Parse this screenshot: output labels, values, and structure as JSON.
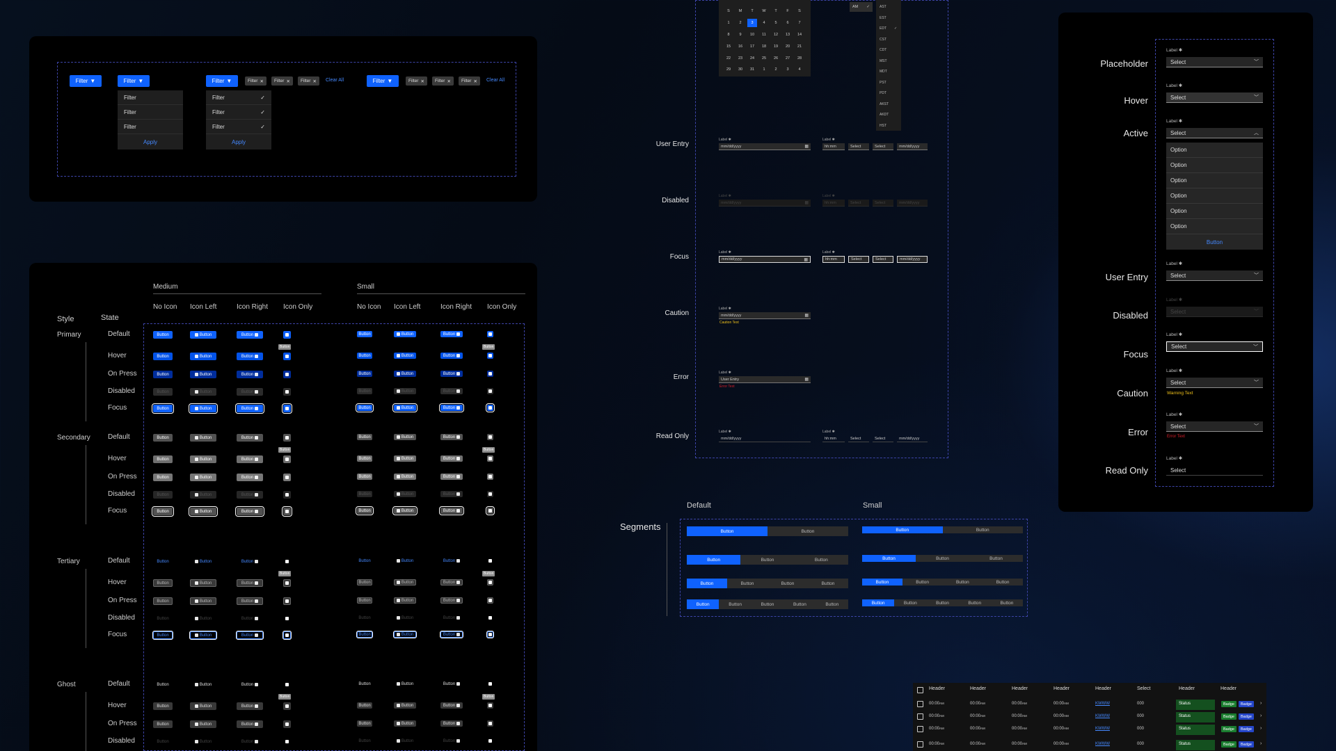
{
  "filters": {
    "filter_label": "Filter",
    "chip_label": "Filter",
    "clear_all": "Clear All",
    "apply": "Apply",
    "menu_items": [
      "Filter",
      "Filter",
      "Filter"
    ]
  },
  "buttons_matrix": {
    "size_headers": [
      "Medium",
      "Small"
    ],
    "col_headers": [
      "No Icon",
      "Icon Left",
      "Icon Right",
      "Icon Only",
      "No Icon",
      "Icon Left",
      "Icon Right",
      "Icon Only"
    ],
    "style_header": "Style",
    "state_header": "State",
    "button_label": "Button",
    "styles": [
      {
        "name": "Primary",
        "states": [
          "Default",
          "Hover",
          "On Press",
          "Disabled",
          "Focus"
        ]
      },
      {
        "name": "Secondary",
        "states": [
          "Default",
          "Hover",
          "On Press",
          "Disabled",
          "Focus"
        ]
      },
      {
        "name": "Tertiary",
        "states": [
          "Default",
          "Hover",
          "On Press",
          "Disabled",
          "Focus"
        ]
      },
      {
        "name": "Ghost",
        "states": [
          "Default",
          "Hover",
          "On Press",
          "Disabled"
        ]
      }
    ]
  },
  "date_inputs": {
    "row_labels": [
      "User Entry",
      "Disabled",
      "Focus",
      "Caution",
      "Error",
      "Read Only"
    ],
    "field_label": "Label ✱",
    "date_placeholder": "mm/dd/yyyy",
    "time_placeholder": "hh:mm",
    "select_label": "Select",
    "user_entry_value": "User Entry",
    "caution_text": "Caution Text",
    "error_text": "Error Text",
    "calendar": {
      "weekdays": [
        "S",
        "M",
        "T",
        "W",
        "T",
        "F",
        "S"
      ],
      "weeks": [
        [
          "",
          "1",
          "2",
          "3",
          "4",
          "5",
          "6",
          "7"
        ],
        [
          "8",
          "9",
          "10",
          "11",
          "12",
          "13",
          "14"
        ],
        [
          "15",
          "16",
          "17",
          "18",
          "19",
          "20",
          "21"
        ],
        [
          "22",
          "23",
          "24",
          "25",
          "26",
          "27",
          "28"
        ],
        [
          "29",
          "30",
          "31",
          "1",
          "2",
          "3",
          "4"
        ]
      ],
      "ampm": "AM",
      "timezones": [
        "AST",
        "EST",
        "EDT",
        "CST",
        "CDT",
        "MST",
        "MDT",
        "PST",
        "PDT",
        "AKST",
        "AKDT",
        "HST"
      ]
    }
  },
  "select_dropdowns": {
    "row_labels": [
      "Placeholder",
      "Hover",
      "Active",
      "User Entry",
      "Disabled",
      "Focus",
      "Caution",
      "Error",
      "Read Only"
    ],
    "field_label": "Label ✱",
    "select_text": "Select",
    "options": [
      "Option",
      "Option",
      "Option",
      "Option",
      "Option",
      "Option"
    ],
    "menu_button": "Button",
    "warning_text": "Warning Text",
    "error_text": "Error Text"
  },
  "segments": {
    "title": "Segments",
    "default_header": "Default",
    "small_header": "Small",
    "button_label": "Button",
    "rows": [
      2,
      3,
      4,
      5
    ]
  },
  "table": {
    "headers": [
      "Header",
      "Header",
      "Header",
      "Header",
      "Header",
      "Select",
      "Header",
      "Header"
    ],
    "time": "00:00",
    "ampm": "AM",
    "link": "KWWW",
    "num": "000",
    "status": "Status",
    "badge": "Badge",
    "row_count": 4
  },
  "colors": {
    "primary": "#0f62fe",
    "panel": "#000000",
    "dash": "#3d44a8",
    "caution": "#f1c21b",
    "error": "#da1e28",
    "status_green": "#1a7d2f"
  }
}
